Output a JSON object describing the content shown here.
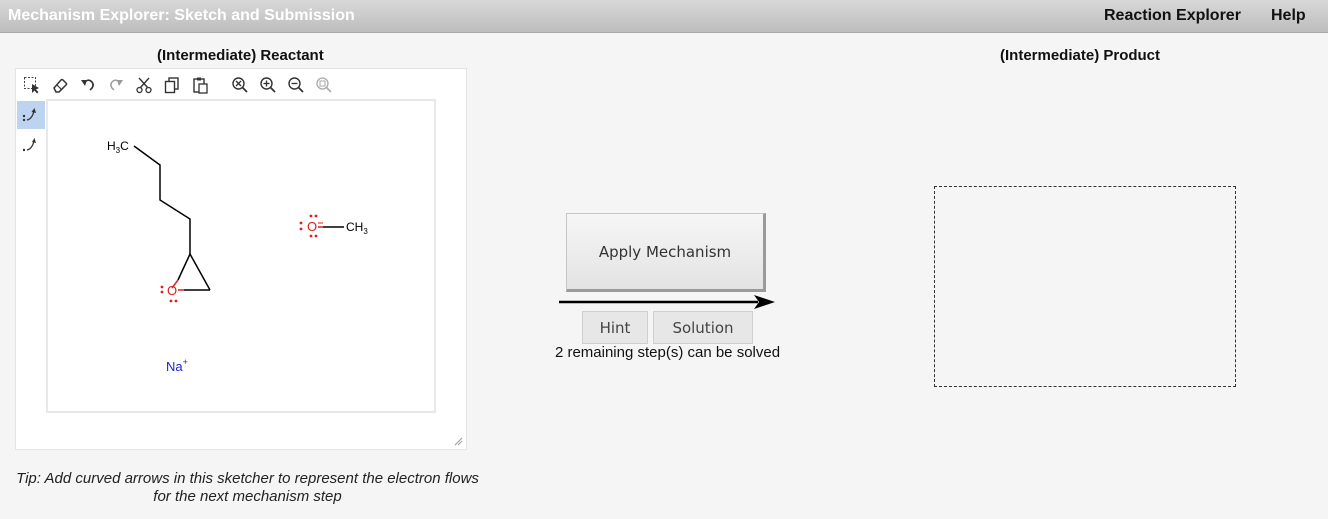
{
  "app": {
    "title": "Mechanism Explorer: Sketch and Submission",
    "menu": [
      "Reaction Explorer",
      "Help"
    ]
  },
  "reactant_panel": {
    "title": "(Intermediate) Reactant",
    "toolbar_icons": [
      "select-icon",
      "eraser-icon",
      "undo-icon",
      "redo-icon",
      "cut-icon",
      "copy-icon",
      "paste-icon",
      "zoom-reset-icon",
      "zoom-in-icon",
      "zoom-out-icon",
      "zoom-fit-icon"
    ],
    "side_tools": [
      "electron-pair-arrow-icon",
      "single-electron-arrow-icon"
    ],
    "molecule_labels": {
      "h3c": "H",
      "h3c_sub": "3",
      "h3c_c": "C",
      "ch3": "CH",
      "ch3_sub": "3",
      "methoxide_o": "O",
      "epoxide_o": "O",
      "sodium": "Na",
      "sodium_charge": "+"
    }
  },
  "tip": "Tip: Add curved arrows in this sketcher to represent the electron flows for the next mechanism step",
  "center": {
    "apply_button": "Apply Mechanism",
    "hint_button": "Hint",
    "solution_button": "Solution",
    "steps_text": "2 remaining step(s) can be solved"
  },
  "product_panel": {
    "title": "(Intermediate) Product"
  },
  "colors": {
    "oxygen": "#dd2020",
    "sodium": "#2020dd",
    "active_tool": "#bcd4f0"
  }
}
